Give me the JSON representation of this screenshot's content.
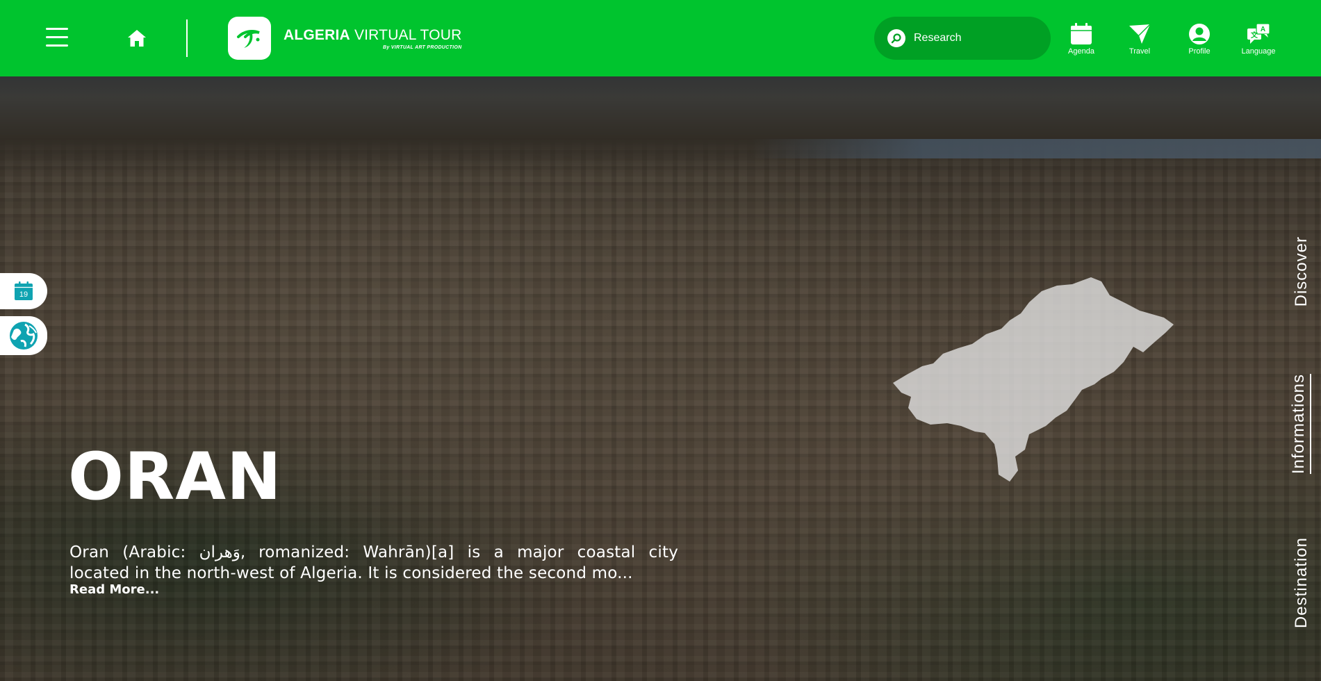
{
  "header": {
    "brand_title_bold": "ALGERIA",
    "brand_title_rest": " VIRTUAL TOUR",
    "brand_subtitle": "By VIRTUAL ART PRODUCTION",
    "search_placeholder": "Research",
    "nav": [
      {
        "label": "Agenda",
        "icon": "calendar-icon"
      },
      {
        "label": "Travel",
        "icon": "paper-plane-icon"
      },
      {
        "label": "Profile",
        "icon": "user-icon"
      },
      {
        "label": "Language",
        "icon": "translate-icon"
      }
    ]
  },
  "side_buttons": {
    "calendar_day": "19"
  },
  "hero": {
    "city_name": "ORAN",
    "description_line1": "Oran (Arabic: وَهران, romanized: Wahrān)[a] is a major coastal city",
    "description_line2": "located in the north-west of Algeria. It is considered the second mo...",
    "read_more": "Read More..."
  },
  "right_tabs": [
    {
      "label": "Discover",
      "active": false
    },
    {
      "label": "Informations",
      "active": true
    },
    {
      "label": "Destination",
      "active": false
    }
  ],
  "colors": {
    "brand_green": "#00c42e",
    "search_green": "#00a024",
    "accent_teal": "#0fa3b1"
  }
}
